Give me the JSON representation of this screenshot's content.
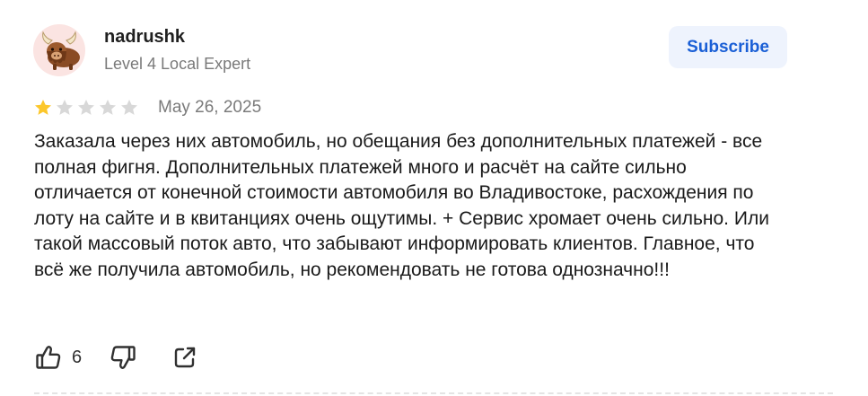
{
  "review": {
    "author": {
      "name": "nadrushk",
      "level": "Level 4 Local Expert",
      "avatar_icon": "yak-emoji-icon",
      "avatar_bg": "#fbe4e2"
    },
    "subscribe_label": "Subscribe",
    "rating": {
      "value": 1,
      "max": 5,
      "filled_color": "#fcc72b",
      "empty_color": "#d8d8d8"
    },
    "date": "May 26, 2025",
    "text": "Заказала через них автомобиль, но обещания без дополнительных платежей - все полная фигня. Дополнительных платежей много и расчёт на сайте сильно отличается от конечной стоимости автомобиля во Владивостоке, расхождения по лоту на сайте и в квитанциях очень ощутимы. + Сервис хромает очень сильно. Или такой массовый поток авто, что забывают информировать клиентов. Главное, что всё же получила автомобиль, но рекомендовать не готова однозначно!!!",
    "actions": {
      "like_icon": "thumbs-up-icon",
      "like_count": "6",
      "dislike_icon": "thumbs-down-icon",
      "share_icon": "share-icon"
    },
    "colors": {
      "accent": "#1a5fd6",
      "subscribe_bg": "#eef3fd",
      "secondary_text": "#7a7a7a"
    }
  }
}
